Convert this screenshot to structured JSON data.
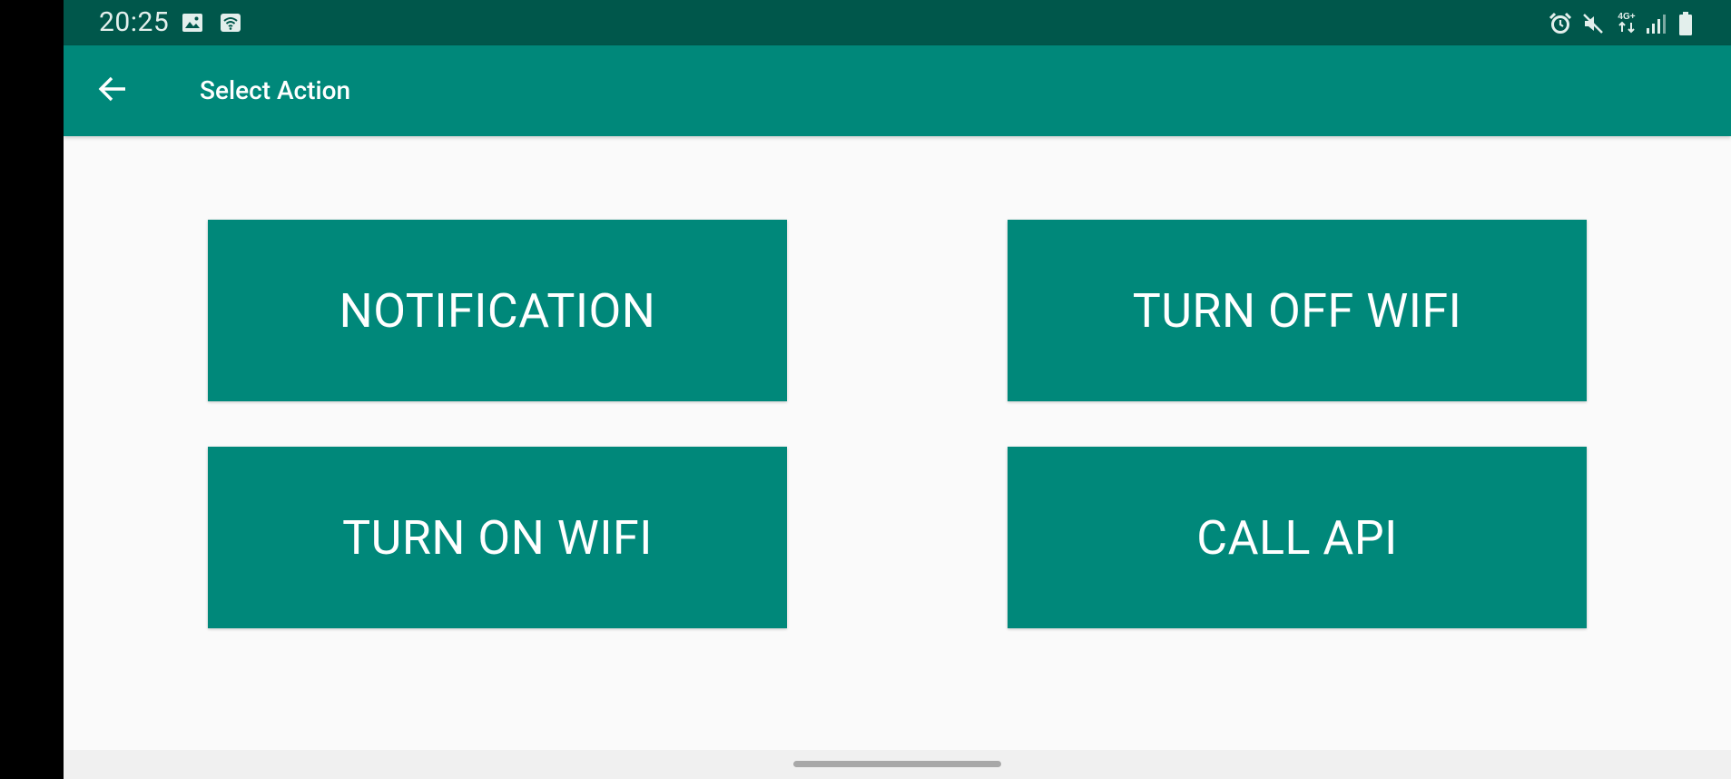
{
  "status_bar": {
    "time": "20:25",
    "left_icons": [
      "image-icon",
      "wifi-icon"
    ],
    "right_icons": [
      "alarm-icon",
      "mute-icon",
      "network-4g-icon",
      "signal-icon",
      "battery-icon"
    ],
    "network_label": "4G+"
  },
  "app_bar": {
    "back_icon": "arrow-back-icon",
    "title": "Select Action"
  },
  "actions": [
    {
      "label": "NOTIFICATION"
    },
    {
      "label": "TURN OFF WIFI"
    },
    {
      "label": "TURN ON WIFI"
    },
    {
      "label": "CALL API"
    }
  ],
  "colors": {
    "status_bar": "#00574b",
    "primary": "#00887a",
    "background": "#fafafa"
  }
}
